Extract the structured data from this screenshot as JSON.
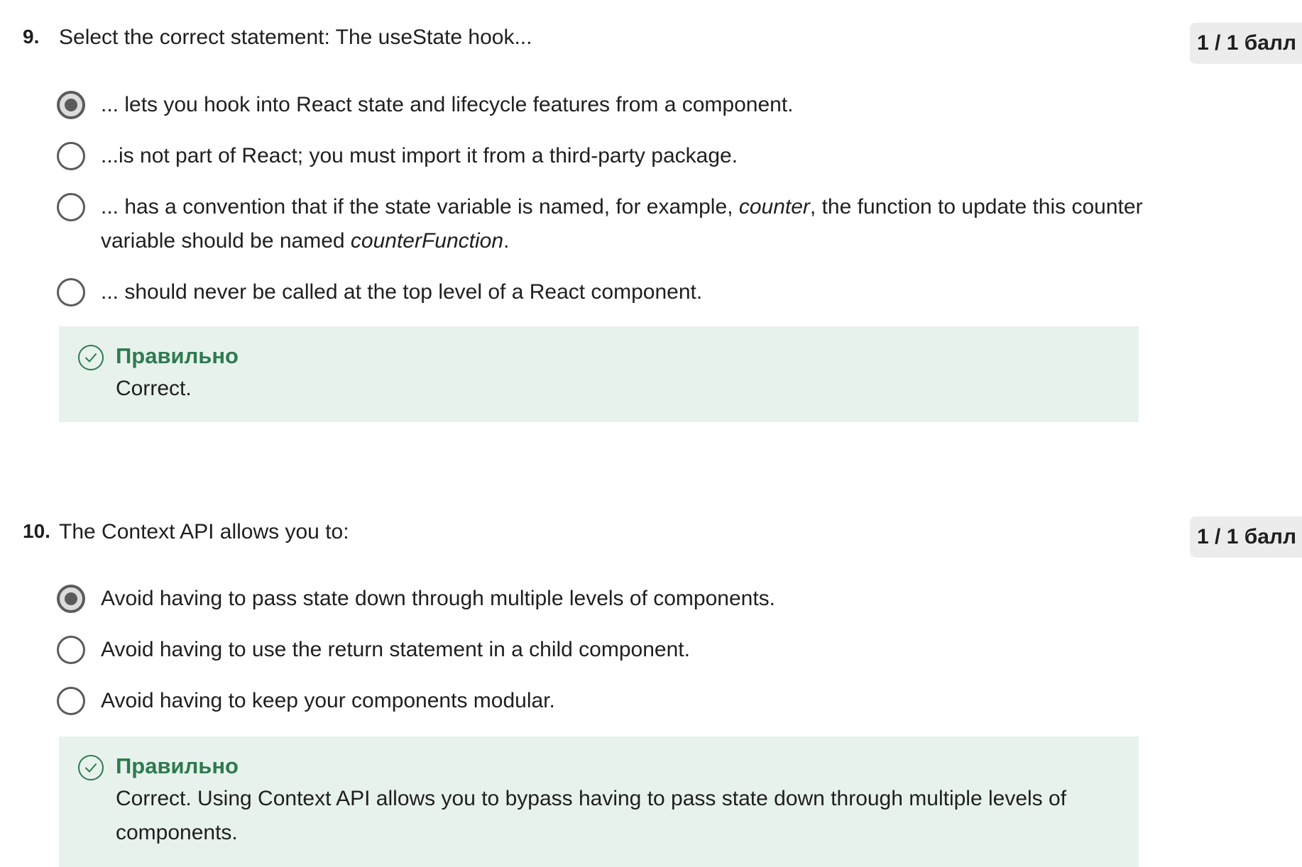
{
  "questions": [
    {
      "number": "9.",
      "text": "Select the correct statement: The useState hook...",
      "score": "1 / 1 балл",
      "options": [
        {
          "label": "... lets you hook into React state and lifecycle features from a component.",
          "selected": true
        },
        {
          "label": "...is not  part of React; you must import it from a third-party package.",
          "selected": false
        },
        {
          "label_parts": [
            "... has a convention that if the state variable is named, for example, ",
            "counter",
            ", the function to update this counter variable should be named ",
            "counterFunction",
            "."
          ],
          "selected": false
        },
        {
          "label": "... should never be called at the top level of a React component.",
          "selected": false
        }
      ],
      "feedback": {
        "title": "Правильно",
        "text": "Correct.",
        "icon": "check-circle-icon",
        "color": "#2f7a4f",
        "background": "#e8f2ec"
      }
    },
    {
      "number": "10.",
      "text": "The Context API allows you to:",
      "score": "1 / 1 балл",
      "options": [
        {
          "label": "Avoid having to pass state down through multiple levels of components.",
          "selected": true
        },
        {
          "label": "Avoid having to use the return statement in a child component.",
          "selected": false
        },
        {
          "label": "Avoid having to keep your components modular.",
          "selected": false
        }
      ],
      "feedback": {
        "title": "Правильно",
        "text": "Correct. Using Context API allows you to bypass having to pass state down through multiple levels of components.",
        "icon": "check-circle-icon",
        "color": "#2f7a4f",
        "background": "#e8f2ec"
      }
    }
  ]
}
